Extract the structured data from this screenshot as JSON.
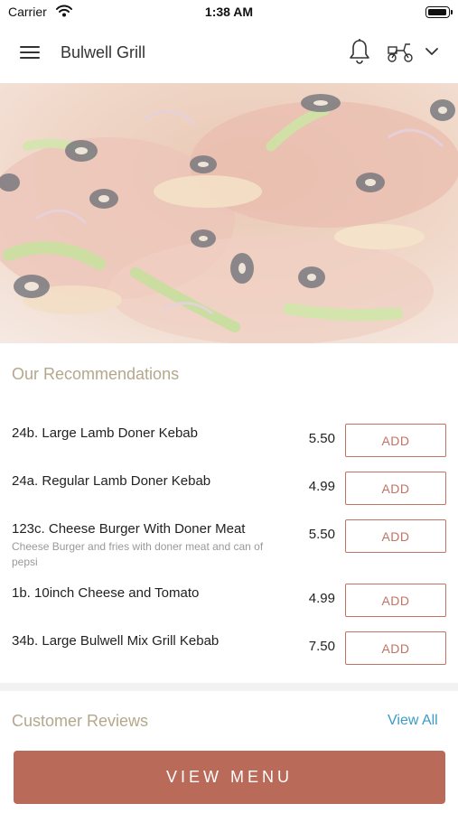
{
  "status_bar": {
    "carrier": "Carrier",
    "time": "1:38 AM"
  },
  "header": {
    "title": "Bulwell Grill",
    "icons": [
      "menu-icon",
      "bell-icon",
      "scooter-icon",
      "chevron-down-icon"
    ]
  },
  "recommendations": {
    "title": "Our Recommendations",
    "items": [
      {
        "name": "24b. Large Lamb Doner Kebab",
        "description": "",
        "price": "5.50",
        "add_label": "ADD"
      },
      {
        "name": "24a. Regular Lamb Doner Kebab",
        "description": "",
        "price": "4.99",
        "add_label": "ADD"
      },
      {
        "name": "123c. Cheese Burger With Doner Meat",
        "description": "Cheese Burger and fries with doner meat and can of pepsi",
        "price": "5.50",
        "add_label": "ADD"
      },
      {
        "name": "1b. 10inch Cheese and Tomato",
        "description": "",
        "price": "4.99",
        "add_label": "ADD"
      },
      {
        "name": "34b. Large Bulwell Mix Grill Kebab",
        "description": "",
        "price": "7.50",
        "add_label": "ADD"
      }
    ]
  },
  "reviews": {
    "title": "Customer Reviews",
    "view_all_label": "View All"
  },
  "footer": {
    "view_menu_label": "VIEW MENU"
  },
  "colors": {
    "accent": "#b96a58",
    "add_border": "#c07464",
    "section_title": "#b4a88c",
    "link": "#3a9bc6"
  }
}
